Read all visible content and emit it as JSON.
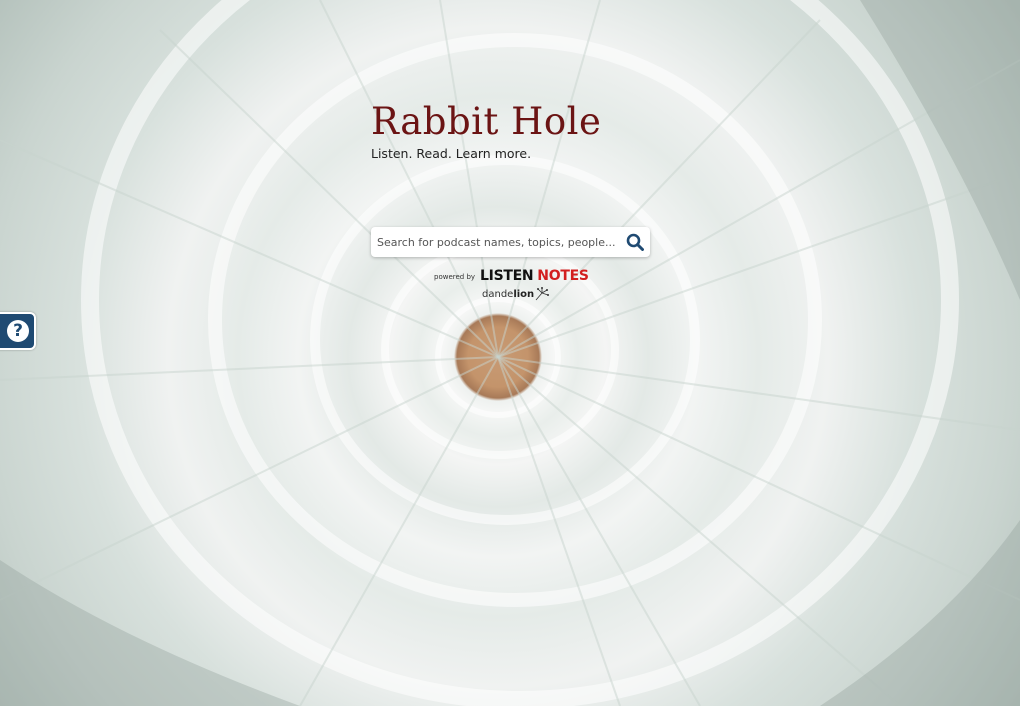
{
  "brand": {
    "title": "Rabbit Hole",
    "tagline_prefix": "Listen. Read.",
    "learn_more": "Learn more."
  },
  "search": {
    "placeholder": "Search for podcast names, topics, people...",
    "value": ""
  },
  "attribution": {
    "powered_by": "powered by",
    "listen": "LISTEN",
    "notes": "NOTES",
    "dandelion_prefix": "dande",
    "dandelion_bold": "lion"
  },
  "help": {
    "icon": "question-circle-icon",
    "glyph": "?"
  },
  "colors": {
    "brand_title": "#6b1414",
    "help_tab": "#1f4a72",
    "search_icon": "#1f4a72",
    "notes_red": "#d21f1f"
  }
}
